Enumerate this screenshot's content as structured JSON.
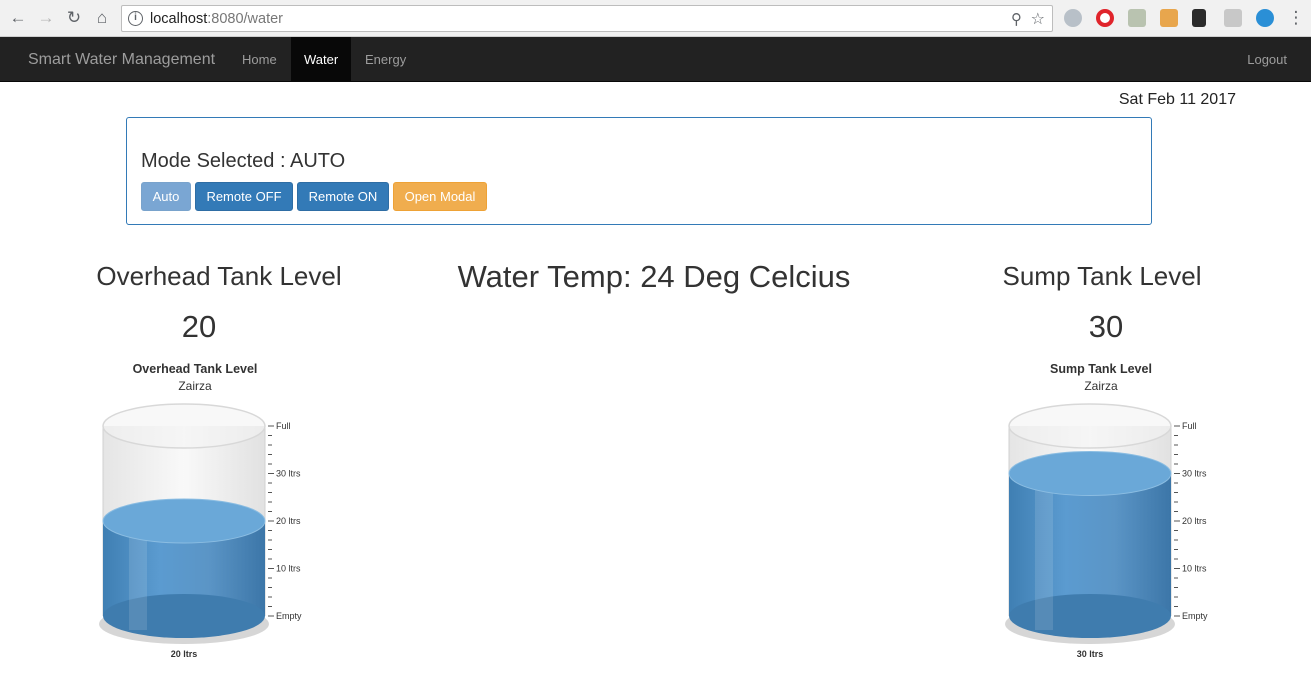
{
  "browser": {
    "url_host": "localhost",
    "url_rest": ":8080/water"
  },
  "navbar": {
    "brand": "Smart Water Management",
    "items": [
      {
        "label": "Home",
        "active": false
      },
      {
        "label": "Water",
        "active": true
      },
      {
        "label": "Energy",
        "active": false
      }
    ],
    "logout": "Logout"
  },
  "date": "Sat Feb 11 2017",
  "mode": {
    "label": "Mode Selected : AUTO",
    "buttons": {
      "auto": "Auto",
      "remote_off": "Remote OFF",
      "remote_on": "Remote ON",
      "open_modal": "Open Modal"
    }
  },
  "overhead": {
    "heading": "Overhead Tank Level",
    "value": "20",
    "chart_title": "Overhead Tank Level",
    "chart_subtitle": "Zairza",
    "bottom_label": "20 ltrs",
    "level": 20
  },
  "temp": {
    "label": "Water Temp: 24 Deg Celcius"
  },
  "sump": {
    "heading": "Sump Tank Level",
    "value": "30",
    "chart_title": "Sump Tank Level",
    "chart_subtitle": "Zairza",
    "bottom_label": "30 ltrs",
    "level": 30
  },
  "scale": {
    "full": "Full",
    "l30": "30 ltrs",
    "l20": "20 ltrs",
    "l10": "10 ltrs",
    "empty": "Empty",
    "max": 40
  },
  "colors": {
    "water": "#5b9bd0",
    "navbar": "#222222",
    "primary": "#337ab7",
    "warning": "#f0ad4e"
  }
}
